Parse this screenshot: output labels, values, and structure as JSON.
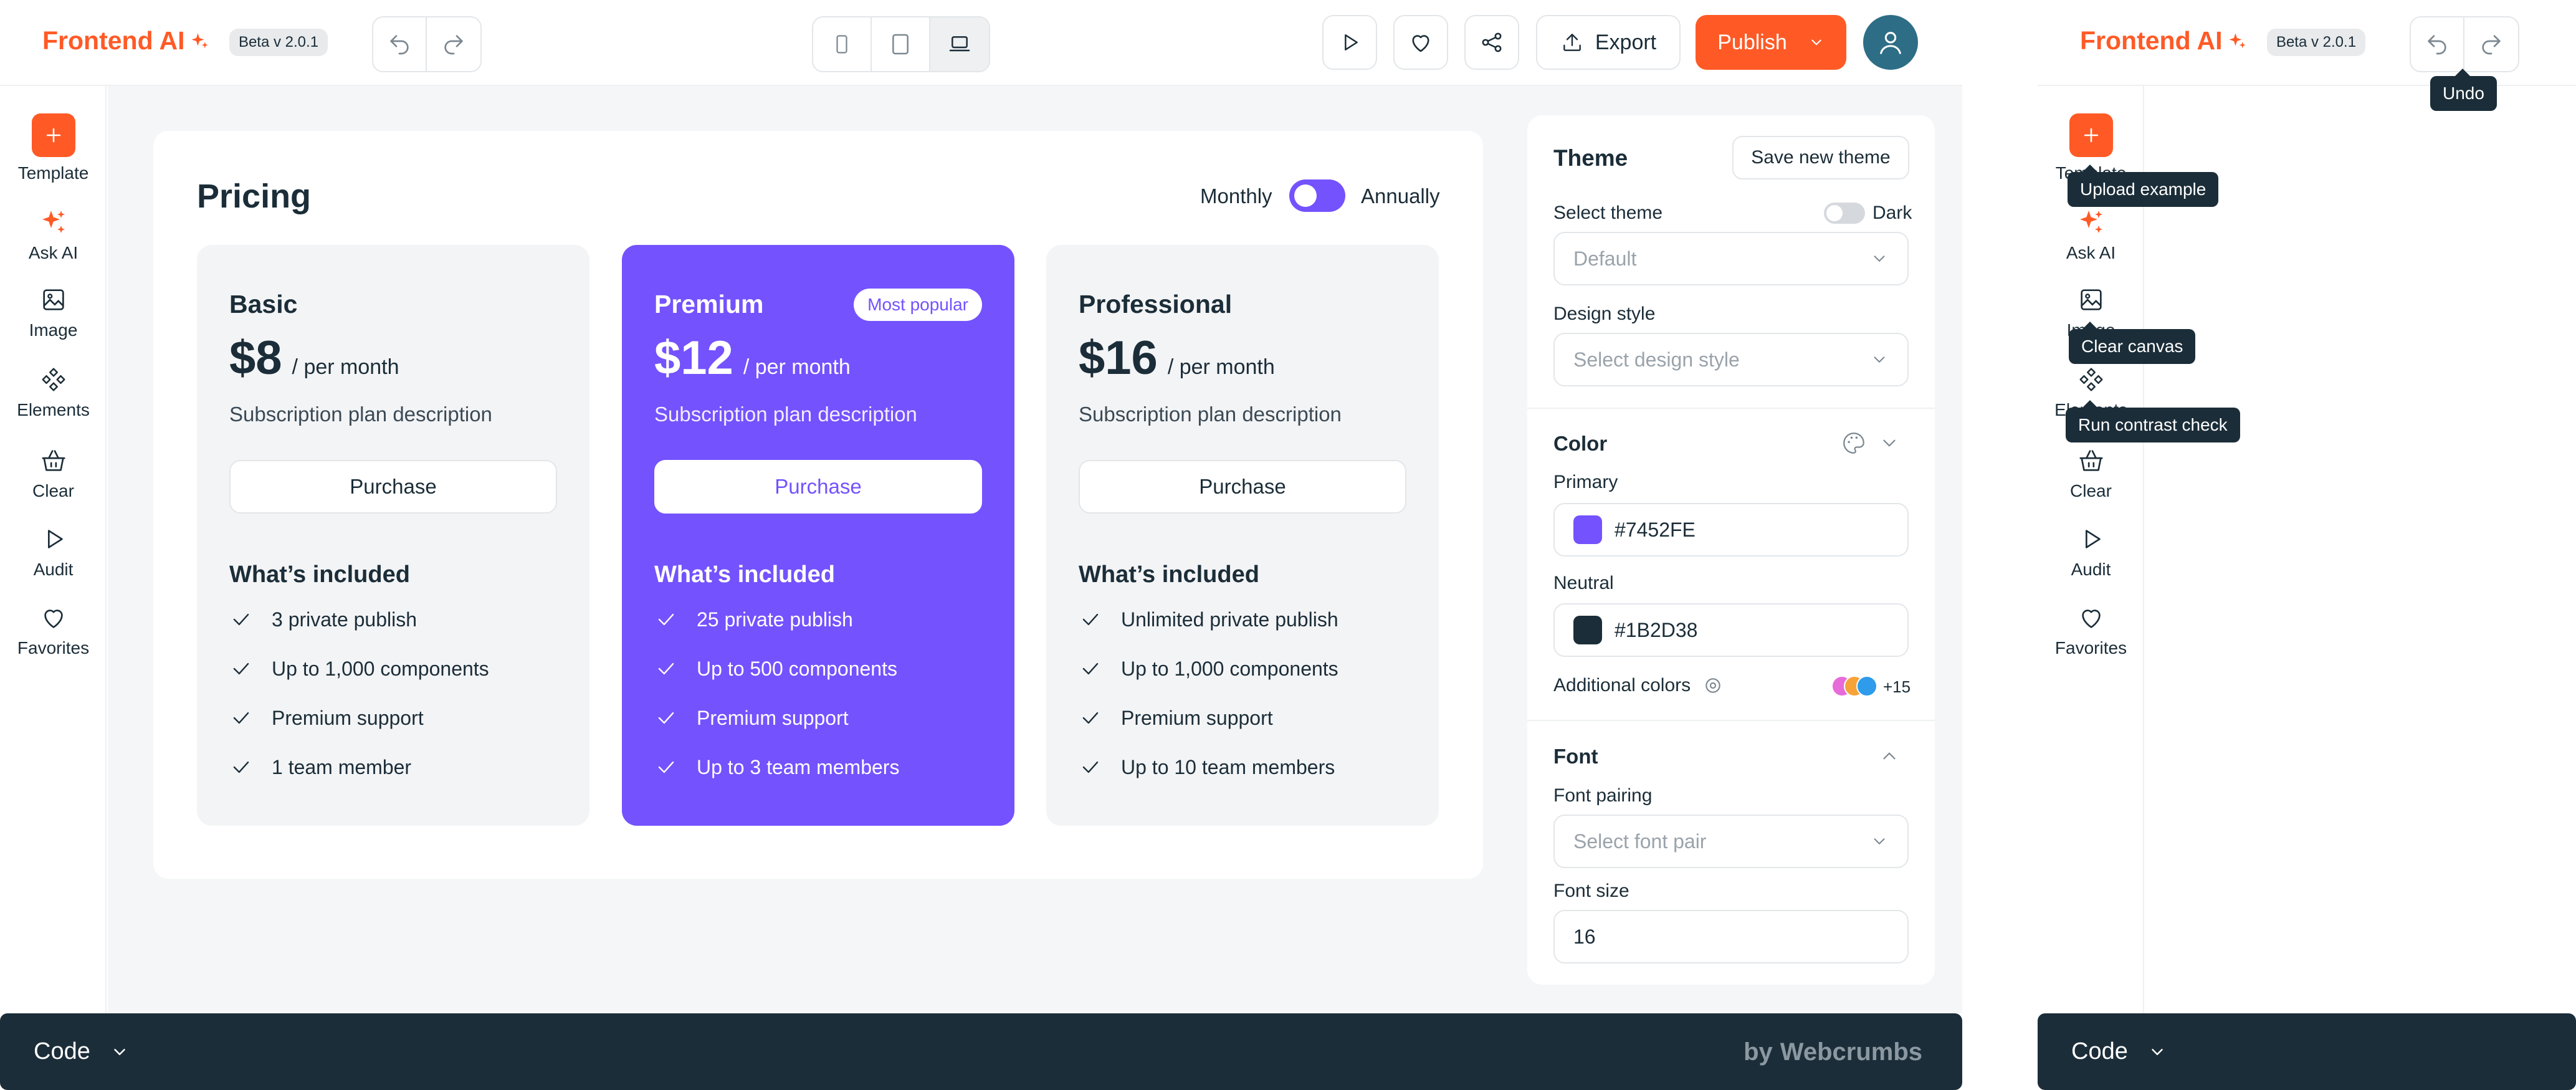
{
  "app": {
    "logo": "Frontend AI",
    "beta": "Beta v 2.0.1"
  },
  "toolbar": {
    "export_label": "Export",
    "publish_label": "Publish"
  },
  "rail": [
    {
      "label": "Template",
      "icon": "plus-icon"
    },
    {
      "label": "Ask AI",
      "icon": "sparkle-icon"
    },
    {
      "label": "Image",
      "icon": "image-icon"
    },
    {
      "label": "Elements",
      "icon": "elements-icon"
    },
    {
      "label": "Clear",
      "icon": "basket-icon"
    },
    {
      "label": "Audit",
      "icon": "play-icon"
    },
    {
      "label": "Favorites",
      "icon": "heart-icon"
    }
  ],
  "pricing": {
    "title": "Pricing",
    "toggle_left": "Monthly",
    "toggle_right": "Annually",
    "plans": [
      {
        "name": "Basic",
        "price": "$8",
        "per": "/ per month",
        "desc": "Subscription plan description",
        "cta": "Purchase",
        "included": "What’s included",
        "features": [
          "3  private publish",
          "Up to 1,000 components",
          "Premium support",
          "1 team member"
        ]
      },
      {
        "name": "Premium",
        "badge": "Most popular",
        "price": "$12",
        "per": "/ per month",
        "desc": "Subscription plan description",
        "cta": "Purchase",
        "included": "What’s included",
        "features": [
          "25  private publish",
          "Up to 500 components",
          "Premium support",
          "Up to 3  team members"
        ]
      },
      {
        "name": "Professional",
        "price": "$16",
        "per": "/ per month",
        "desc": "Subscription plan description",
        "cta": "Purchase",
        "included": "What’s included",
        "features": [
          "Unlimited private publish",
          "Up to 1,000 components",
          "Premium support",
          "Up to 10 team members"
        ]
      }
    ]
  },
  "theme": {
    "title": "Theme",
    "save_label": "Save new theme",
    "select_theme_label": "Select theme",
    "dark_label": "Dark",
    "select_theme_placeholder": "Default",
    "design_style_label": "Design style",
    "design_style_placeholder": "Select design style",
    "color_title": "Color",
    "primary_label": "Primary",
    "primary_value": "#7452FE",
    "neutral_label": "Neutral",
    "neutral_value": "#1B2D38",
    "additional_label": "Additional colors",
    "additional_count": "+15",
    "font_title": "Font",
    "font_pairing_label": "Font pairing",
    "font_pairing_placeholder": "Select font pair",
    "font_size_label": "Font size",
    "font_size_value": "16"
  },
  "codebar": {
    "label": "Code",
    "by": "by",
    "brand": "Webcrumbs"
  },
  "mini": {
    "logo": "Frontend AI",
    "beta": "Beta v 2.0.1",
    "rail": [
      "Template",
      "Ask AI",
      "Image",
      "Elements",
      "Clear",
      "Audit",
      "Favorites"
    ],
    "tooltips": {
      "undo": "Undo",
      "upload": "Upload example",
      "clear": "Clear canvas",
      "contrast": "Run contrast check"
    },
    "code_label": "Code"
  },
  "colors": {
    "brand": "#FF5A26",
    "primary": "#7452FE",
    "neutral": "#1B2D38"
  }
}
